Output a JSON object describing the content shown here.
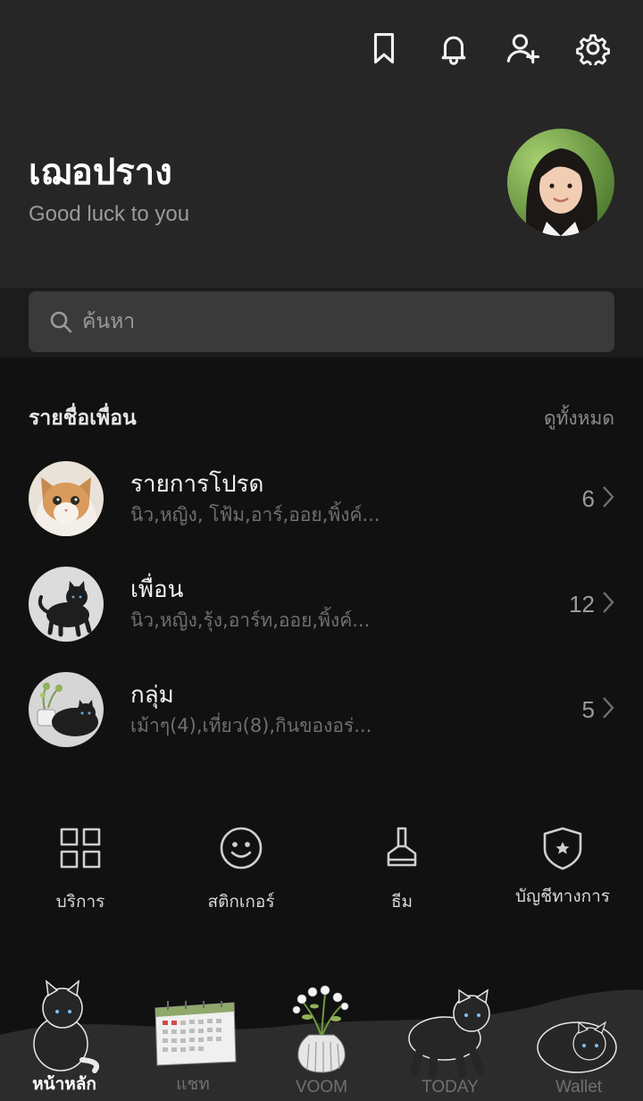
{
  "header": {
    "icons": [
      "bookmark-icon",
      "bell-icon",
      "add-friend-icon",
      "settings-icon"
    ],
    "profile_name": "เฌอปราง",
    "status_message": "Good luck to you"
  },
  "search": {
    "placeholder": "ค้นหา"
  },
  "friends_section": {
    "title": "รายชื่อเพื่อน",
    "see_all": "ดูทั้งหมด",
    "rows": [
      {
        "title": "รายการโปรด",
        "subtitle": "นิว,หญิง, โฟ้ม,อาร์,ออย,พิ้งค์...",
        "count": "6"
      },
      {
        "title": "เพื่อน",
        "subtitle": "นิว,หญิง,รุ้ง,อาร์ท,ออย,พิ้งค์...",
        "count": "12"
      },
      {
        "title": "กลุ่ม",
        "subtitle": "เม้าๆ(4),เที่ยว(8),กินของอร่...",
        "count": "5"
      }
    ]
  },
  "services": [
    {
      "label": "บริการ",
      "icon": "grid-icon"
    },
    {
      "label": "สติกเกอร์",
      "icon": "smiley-icon"
    },
    {
      "label": "ธีม",
      "icon": "brush-icon"
    },
    {
      "label": "บัญชีทางการ",
      "icon": "shield-star-icon"
    }
  ],
  "bottom_nav": [
    {
      "label": "หน้าหลัก",
      "active": true
    },
    {
      "label": "แชท",
      "active": false
    },
    {
      "label": "VOOM",
      "active": false
    },
    {
      "label": "TODAY",
      "active": false
    },
    {
      "label": "Wallet",
      "active": false
    }
  ],
  "colors": {
    "header_bg": "#262626",
    "body_bg": "#111111",
    "search_bg": "#3a3a3a",
    "muted_text": "#6f6f6f"
  }
}
